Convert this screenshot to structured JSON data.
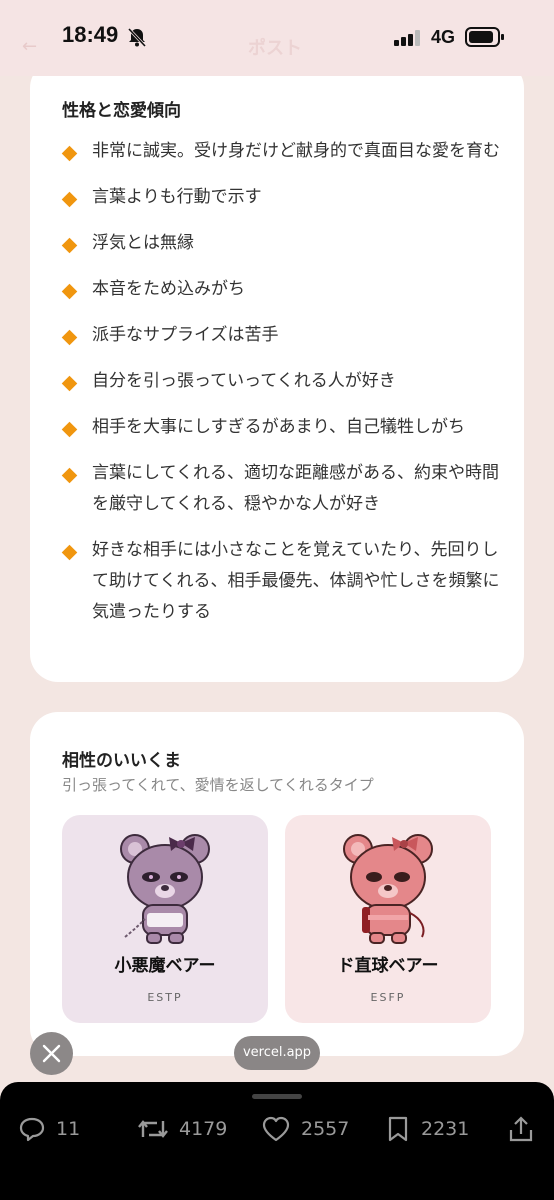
{
  "status_bar": {
    "time": "18:49",
    "network": "4G",
    "faded_title": "ポスト"
  },
  "traits": {
    "title": "性格と恋愛傾向",
    "items": [
      "非常に誠実。受け身だけど献身的で真面目な愛を育む",
      "言葉よりも行動で示す",
      "浮気とは無縁",
      "本音をため込みがち",
      "派手なサプライズは苦手",
      "自分を引っ張っていってくれる人が好き",
      "相手を大事にしすぎるがあまり、自己犠牲しがち",
      "言葉にしてくれる、適切な距離感がある、約束や時間を厳守してくれる、穏やかな人が好き",
      "好きな相手には小さなことを覚えていたり、先回りして助けてくれる、相手最優先、体調や忙しさを頻繁に気遣ったりする"
    ]
  },
  "compat": {
    "title": "相性のいいくま",
    "subtitle": "引っ張ってくれて、愛情を返してくれるタイプ",
    "bears": [
      {
        "name": "小悪魔ベアー",
        "type": "ESTP"
      },
      {
        "name": "ド直球ベアー",
        "type": "ESFP"
      }
    ]
  },
  "overlay": {
    "url": "vercel.app"
  },
  "actions": {
    "replies": "11",
    "reposts": "4179",
    "likes": "2557",
    "bookmarks": "2231"
  },
  "colors": {
    "accent": "#f0960f",
    "page_bg": "#f3e6e2",
    "bear1_bg": "#eee3ec",
    "bear2_bg": "#f8e6e7"
  }
}
